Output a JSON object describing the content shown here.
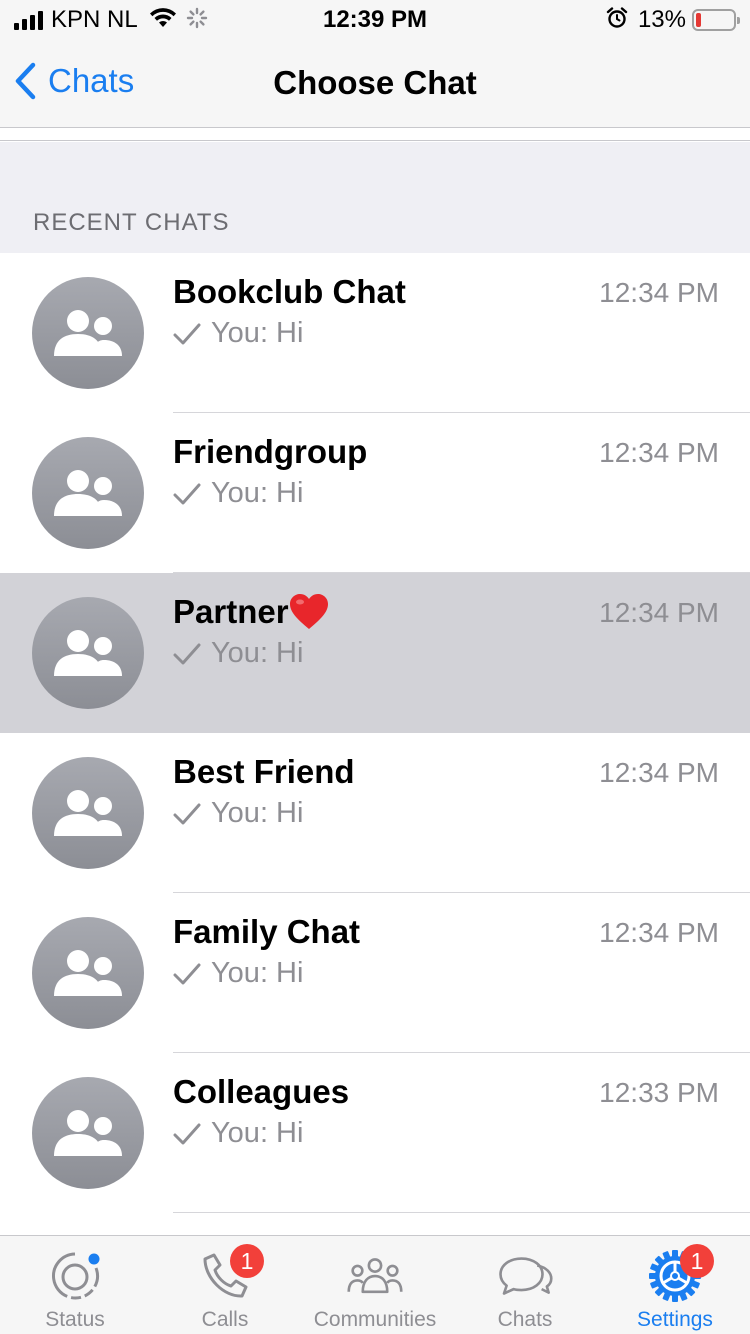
{
  "status_bar": {
    "carrier": "KPN NL",
    "time": "12:39 PM",
    "battery": "13%",
    "battery_level": 0.13
  },
  "nav": {
    "back_label": "Chats",
    "title": "Choose Chat"
  },
  "section": {
    "title": "RECENT CHATS"
  },
  "chats": [
    {
      "name": "Bookclub Chat",
      "time": "12:34 PM",
      "preview": "You: Hi"
    },
    {
      "name": "Friendgroup",
      "time": "12:34 PM",
      "preview": "You: Hi"
    },
    {
      "name": "Partner",
      "emoji": "heart-icon",
      "time": "12:34 PM",
      "preview": "You: Hi",
      "selected": true
    },
    {
      "name": "Best Friend",
      "time": "12:34 PM",
      "preview": "You: Hi"
    },
    {
      "name": "Family Chat",
      "time": "12:34 PM",
      "preview": "You: Hi"
    },
    {
      "name": "Colleagues",
      "time": "12:33 PM",
      "preview": "You: Hi"
    }
  ],
  "tabs": [
    {
      "label": "Status",
      "icon": "status-icon"
    },
    {
      "label": "Calls",
      "icon": "phone-icon",
      "badge": "1"
    },
    {
      "label": "Communities",
      "icon": "communities-icon"
    },
    {
      "label": "Chats",
      "icon": "chats-icon"
    },
    {
      "label": "Settings",
      "icon": "settings-icon",
      "badge": "1",
      "active": true
    }
  ],
  "colors": {
    "accent": "#1a7ef0",
    "badge": "#f2403a",
    "selected_row": "#d2d2d7",
    "secondary_text": "#8e8e93"
  }
}
